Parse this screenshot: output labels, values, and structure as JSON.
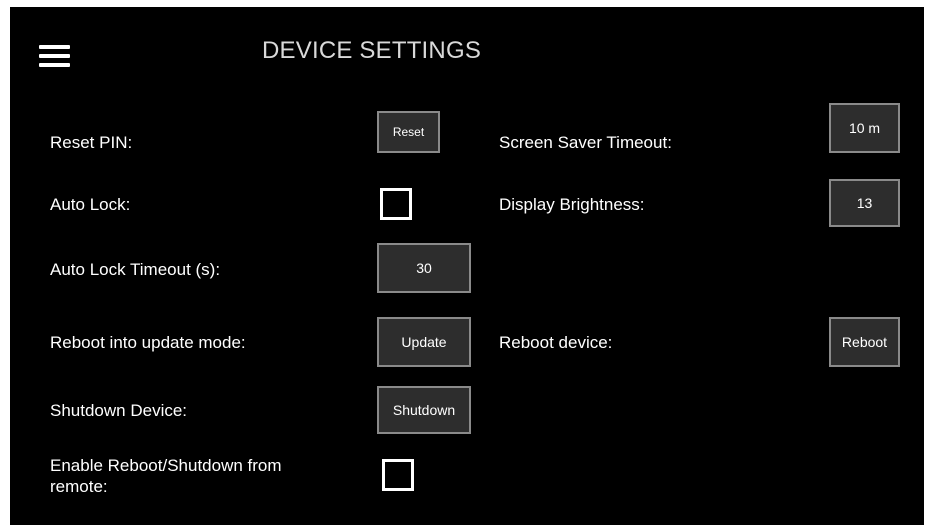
{
  "header": {
    "title": "DEVICE SETTINGS",
    "menu_icon": "hamburger-menu-icon"
  },
  "settings": {
    "reset_pin": {
      "label": "Reset PIN:",
      "button": "Reset"
    },
    "auto_lock": {
      "label": "Auto Lock:",
      "checked": false
    },
    "auto_lock_timeout": {
      "label": "Auto Lock Timeout (s):",
      "value": "30"
    },
    "reboot_update": {
      "label": "Reboot into update mode:",
      "button": "Update"
    },
    "shutdown": {
      "label": "Shutdown Device:",
      "button": "Shutdown"
    },
    "remote_reboot": {
      "label": "Enable Reboot/Shutdown from remote:",
      "checked": false
    },
    "screen_saver_timeout": {
      "label": "Screen Saver Timeout:",
      "value": "10 m"
    },
    "display_brightness": {
      "label": "Display Brightness:",
      "value": "13"
    },
    "reboot_device": {
      "label": "Reboot device:",
      "button": "Reboot"
    }
  },
  "colors": {
    "background": "#000000",
    "text": "#ffffff",
    "title": "#d9d9d9",
    "button_bg": "#2d2d2d",
    "button_border": "#8a8a8a"
  }
}
